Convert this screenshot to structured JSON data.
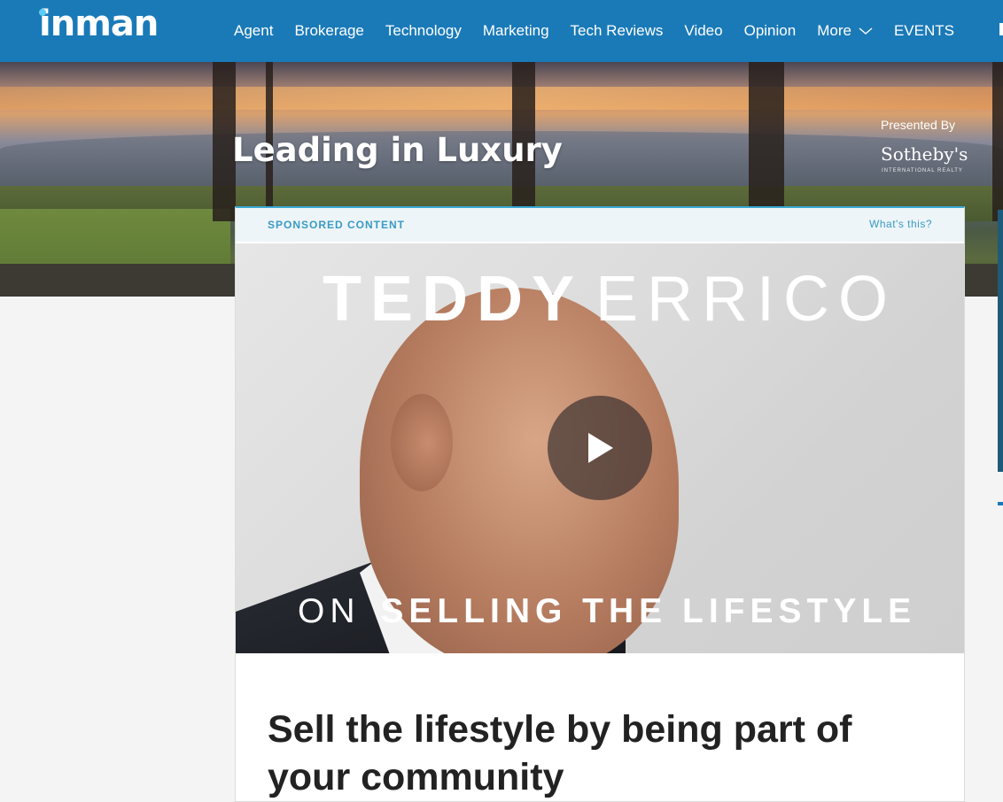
{
  "nav": {
    "logo": "inman",
    "items": [
      {
        "label": "Agent"
      },
      {
        "label": "Brokerage"
      },
      {
        "label": "Technology"
      },
      {
        "label": "Marketing"
      },
      {
        "label": "Tech Reviews"
      },
      {
        "label": "Video"
      },
      {
        "label": "Opinion"
      },
      {
        "label": "More",
        "icon": "chevron-down-icon"
      },
      {
        "label": "EVENTS"
      }
    ]
  },
  "hero": {
    "title": "Leading in Luxury",
    "presented_by": "Presented By",
    "sponsor_logo": "Sotheby's",
    "sponsor_logo_sub": "INTERNATIONAL REALTY"
  },
  "article": {
    "sponsor_label": "SPONSORED CONTENT",
    "whats_this": "What's this?",
    "video": {
      "title_first": "TEDDY",
      "title_last": "ERRICO",
      "subtitle_prefix": "ON",
      "subtitle_main": "SELLING THE LIFESTYLE",
      "play_icon": "play-icon"
    },
    "headline": "Sell the lifestyle by being part of your community"
  },
  "colors": {
    "nav_bg": "#1a7ab8",
    "accent": "#3a9ac4",
    "sponsor_bar_bg": "#eef5f8",
    "page_bg": "#f4f4f4"
  }
}
